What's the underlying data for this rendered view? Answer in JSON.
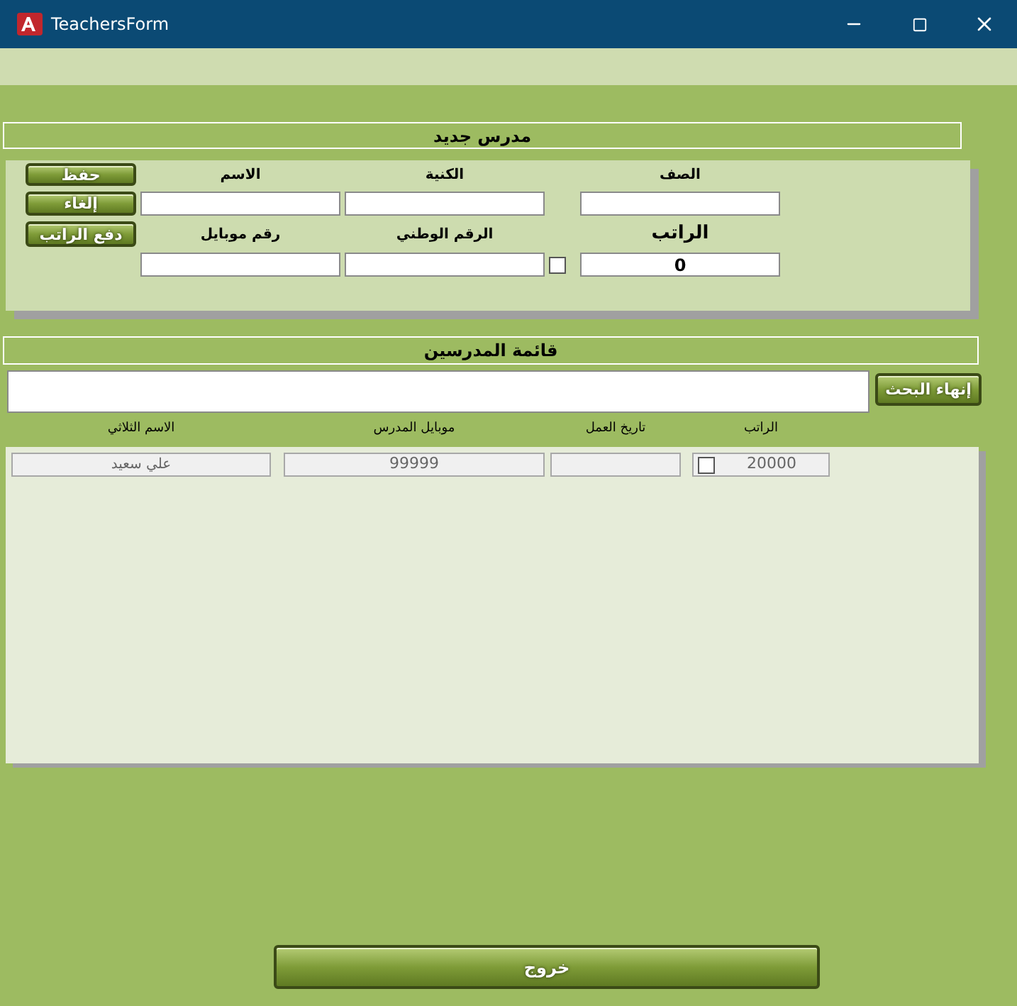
{
  "window": {
    "title": "TeachersForm"
  },
  "new_teacher": {
    "title": "مدرس جديد",
    "buttons": [
      "حفظ",
      "إلغاء",
      "دفع الراتب"
    ],
    "fields": [
      {
        "label": "الصف"
      },
      {
        "label": "الكنية"
      },
      {
        "label": "الاسم"
      },
      {
        "label": "الراتب",
        "value": "0"
      },
      {
        "label": "الرقم الوطني"
      },
      {
        "label": "رقم موبايل"
      }
    ],
    "paid_checkbox": {
      "checked": false
    }
  },
  "teachers_list": {
    "title": "قائمة المدرسين",
    "search_button": "إنهاء البحث",
    "columns": [
      "الراتب",
      "تاريخ العمل",
      "موبايل المدرس",
      "الاسم الثلاثي"
    ],
    "rows": [
      {
        "name": "علي سعيد",
        "mobile": "99999",
        "salary": "20000",
        "checked": false
      }
    ]
  },
  "exit_button": "خروج"
}
